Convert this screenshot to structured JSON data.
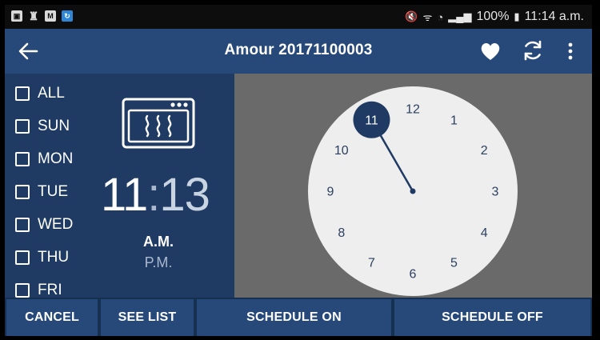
{
  "status_bar": {
    "battery": "100%",
    "time": "11:14 a.m.",
    "left_icons": [
      "photo-icon",
      "bug-icon",
      "gmail-icon",
      "sync-app-icon"
    ]
  },
  "app_bar": {
    "title": "Amour 20171100003"
  },
  "days": [
    {
      "label": "ALL",
      "checked": false
    },
    {
      "label": "SUN",
      "checked": false
    },
    {
      "label": "MON",
      "checked": false
    },
    {
      "label": "TUE",
      "checked": false
    },
    {
      "label": "WED",
      "checked": false
    },
    {
      "label": "THU",
      "checked": false
    },
    {
      "label": "FRI",
      "checked": false
    }
  ],
  "time": {
    "hour": "11",
    "separator": ":",
    "minute": "13",
    "am": "A.M.",
    "pm": "P.M.",
    "selected_period": "A.M."
  },
  "clock": {
    "numbers": [
      "12",
      "1",
      "2",
      "3",
      "4",
      "5",
      "6",
      "7",
      "8",
      "9",
      "10",
      "11"
    ],
    "selected_hour": "11"
  },
  "buttons": {
    "cancel": "CANCEL",
    "see_list": "SEE LIST",
    "schedule_on": "SCHEDULE ON",
    "schedule_off": "SCHEDULE OFF"
  },
  "colors": {
    "app_bar": "#27497a",
    "panel": "#1f3b64",
    "clock_bg": "#6a6a6a",
    "clock_face": "#eeeeee",
    "accent": "#1f3b64"
  }
}
